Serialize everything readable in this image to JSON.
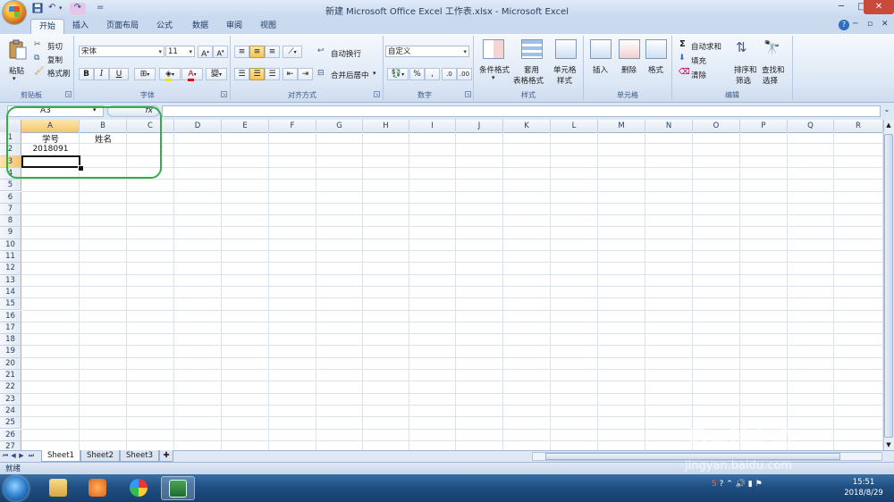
{
  "window": {
    "title": "新建 Microsoft Office Excel 工作表.xlsx - Microsoft Excel",
    "qat_undo": "↶",
    "qat_redo": "↷",
    "qat_more": "=",
    "min": "─",
    "max": "□",
    "close": "✕"
  },
  "ribbon": {
    "tabs": [
      "开始",
      "插入",
      "页面布局",
      "公式",
      "数据",
      "审阅",
      "视图"
    ],
    "active_tab": "开始",
    "help": "?",
    "clipboard": {
      "label": "剪贴板",
      "paste": "粘贴",
      "cut": "剪切",
      "copy": "复制",
      "format_painter": "格式刷"
    },
    "font": {
      "label": "字体",
      "name": "宋体",
      "size": "11",
      "bold": "B",
      "italic": "I",
      "underline": "U",
      "grow": "A",
      "shrink": "A"
    },
    "alignment": {
      "label": "对齐方式",
      "wrap": "自动换行",
      "merge": "合并后居中"
    },
    "number": {
      "label": "数字",
      "format": "自定义",
      "percent": "%"
    },
    "styles": {
      "label": "样式",
      "conditional": "条件格式",
      "table_line1": "套用",
      "table_line2": "表格格式",
      "cell_line1": "单元格",
      "cell_line2": "样式"
    },
    "cells": {
      "label": "单元格",
      "insert": "插入",
      "delete": "删除",
      "format": "格式"
    },
    "editing": {
      "label": "编辑",
      "autosum": "自动求和",
      "fill": "填充",
      "clear": "清除",
      "sort_line1": "排序和",
      "sort_line2": "筛选",
      "find_line1": "查找和",
      "find_line2": "选择"
    }
  },
  "formula_bar": {
    "name_box": "A3",
    "fx": "fx",
    "formula": ""
  },
  "sheet": {
    "columns": [
      "A",
      "B",
      "C",
      "D",
      "E",
      "F",
      "G",
      "H",
      "I",
      "J",
      "K",
      "L",
      "M",
      "N",
      "O",
      "P",
      "Q",
      "R"
    ],
    "rows": [
      "1",
      "2",
      "3",
      "4",
      "5",
      "6",
      "7",
      "8",
      "9",
      "10",
      "11",
      "12",
      "13",
      "14",
      "15",
      "16",
      "17",
      "18",
      "19",
      "20",
      "21",
      "22",
      "23",
      "24",
      "25",
      "26",
      "27"
    ],
    "selected_col": "A",
    "selected_row": "3",
    "cells": {
      "A1": "学号",
      "B1": "姓名",
      "A2": "2018091"
    }
  },
  "sheet_tabs": [
    "Sheet1",
    "Sheet2",
    "Sheet3"
  ],
  "active_sheet": "Sheet1",
  "status": "就绪",
  "taskbar": {
    "time": "15:51",
    "date": "2018/8/29"
  },
  "watermark": {
    "brand": "Bai经验",
    "url": "jingyan.baidu.com"
  }
}
